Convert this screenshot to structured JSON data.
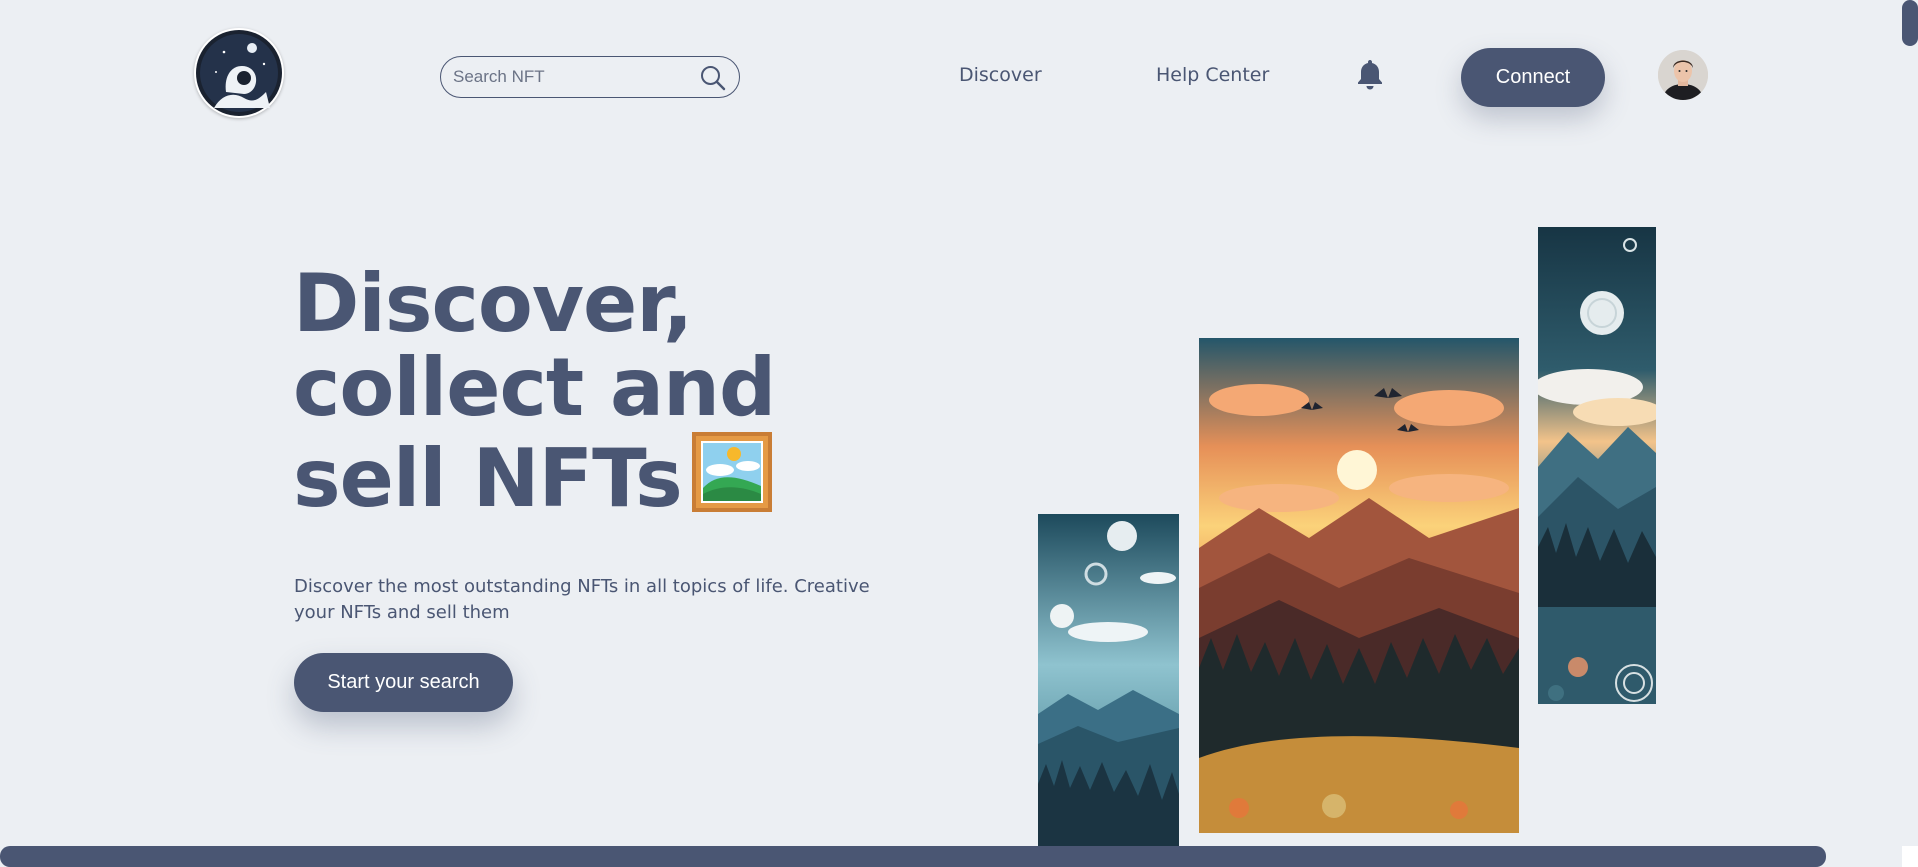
{
  "header": {
    "logo_icon": "astronaut-logo-icon",
    "search": {
      "placeholder": "Search NFT",
      "value": "",
      "icon": "search-icon"
    },
    "nav": [
      {
        "label": "Discover"
      },
      {
        "label": "Help Center"
      }
    ],
    "notification_icon": "bell-icon",
    "connect_label": "Connect",
    "avatar_icon": "user-avatar"
  },
  "hero": {
    "title_lines": [
      "Discover,",
      "collect and",
      "sell NFTs"
    ],
    "title_emoji_icon": "framed-picture-icon",
    "subtitle": "Discover the most outstanding NFTs in all topics of life. Creative your NFTs and sell them",
    "cta_label": "Start your search"
  },
  "artworks": [
    {
      "name": "misty-forest-artwork"
    },
    {
      "name": "sunset-mountains-artwork"
    },
    {
      "name": "moon-mountains-artwork"
    }
  ],
  "colors": {
    "background": "#eceff3",
    "primary": "#4a5673",
    "button_text": "#ffffff"
  }
}
